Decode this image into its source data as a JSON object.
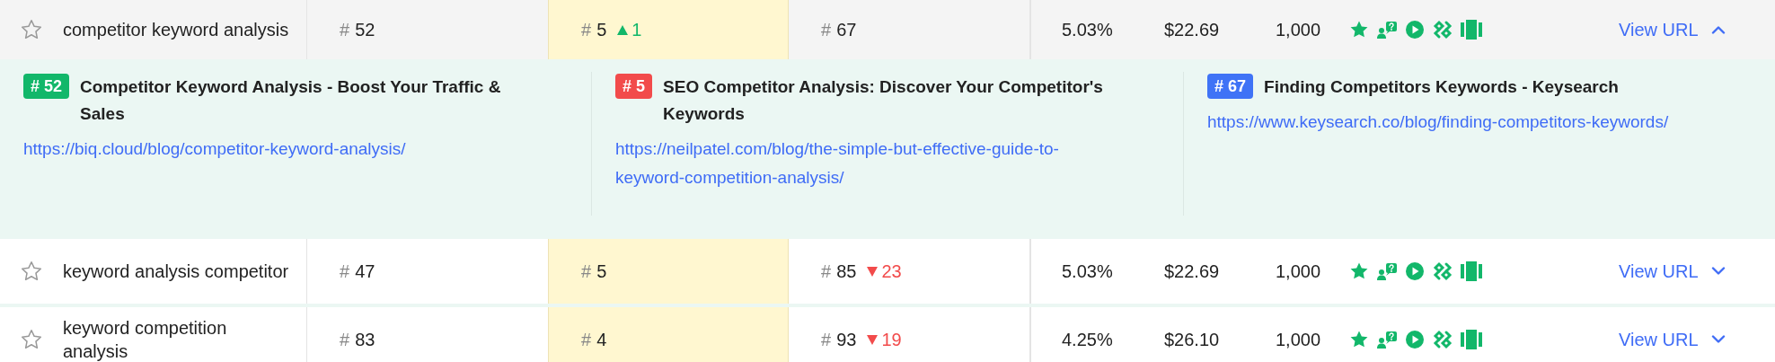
{
  "rows": [
    {
      "starred": false,
      "keyword": "competitor keyword analysis",
      "rank_1": {
        "hash": "#",
        "value": "52"
      },
      "rank_2": {
        "hash": "#",
        "value": "5",
        "change": {
          "kind": "up",
          "amount": "1"
        }
      },
      "rank_3": {
        "hash": "#",
        "value": "67"
      },
      "share": "5.03%",
      "cpc": "$22.69",
      "volume": "1,000",
      "link": "View URL",
      "expanded": true,
      "results": [
        {
          "badge": "# 52",
          "color": "#12b76a",
          "title": "Competitor Keyword Analysis - Boost Your Traffic & Sales",
          "url": "https://biq.cloud/blog/competitor-keyword-analysis/"
        },
        {
          "badge": "# 5",
          "color": "#f24b4b",
          "title": "SEO Competitor Analysis: Discover Your Competitor's Keywords",
          "url": "https://neilpatel.com/blog/the-simple-but-effective-guide-to-keyword-competition-analysis/"
        },
        {
          "badge": "# 67",
          "color": "#3f73f6",
          "title": "Finding Competitors Keywords - Keysearch",
          "url": "https://www.keysearch.co/blog/finding-competitors-keywords/"
        }
      ]
    },
    {
      "starred": false,
      "keyword": "keyword analysis competitor",
      "rank_1": {
        "hash": "#",
        "value": "47"
      },
      "rank_2": {
        "hash": "#",
        "value": "5"
      },
      "rank_3": {
        "hash": "#",
        "value": "85",
        "change": {
          "kind": "down",
          "amount": "23"
        }
      },
      "share": "5.03%",
      "cpc": "$22.69",
      "volume": "1,000",
      "link": "View URL",
      "expanded": false
    },
    {
      "starred": false,
      "keyword": "keyword competition analysis",
      "rank_1": {
        "hash": "#",
        "value": "83"
      },
      "rank_2": {
        "hash": "#",
        "value": "4"
      },
      "rank_3": {
        "hash": "#",
        "value": "93",
        "change": {
          "kind": "down",
          "amount": "19"
        }
      },
      "share": "4.25%",
      "cpc": "$26.10",
      "volume": "1,000",
      "link": "View URL",
      "expanded": false
    }
  ]
}
